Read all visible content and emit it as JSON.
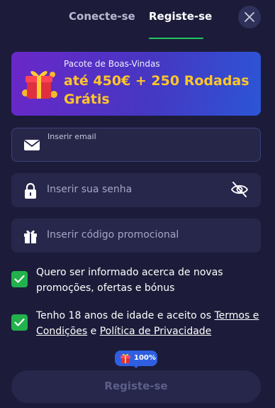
{
  "tabs": {
    "login": "Conecte-se",
    "register": "Registe-se"
  },
  "promo": {
    "subtitle": "Pacote de Boas-Vindas",
    "headline": "até 450€ + 250 Rodadas Grátis"
  },
  "fields": {
    "email_placeholder": "Inserir email",
    "password_placeholder": "Inserir sua senha",
    "promo_placeholder": "Inserir código promocional"
  },
  "checks": {
    "newsletter": "Quero ser informado acerca de novas promoções, ofertas e bónus",
    "age_prefix": "Tenho 18 anos de idade e aceito os ",
    "terms_link": "Termos e Condições",
    "and": " e ",
    "privacy_link": "Política de Privacidade"
  },
  "submit": {
    "label": "Registe-se",
    "badge": "100%"
  },
  "colors": {
    "background": "#1c1c3a",
    "accent_green": "#22c55e",
    "promo_yellow": "#ffc629"
  },
  "icons": [
    "close-icon",
    "gift-icon",
    "envelope-icon",
    "lock-icon",
    "eye-off-icon",
    "gift-box-icon",
    "check-icon"
  ]
}
